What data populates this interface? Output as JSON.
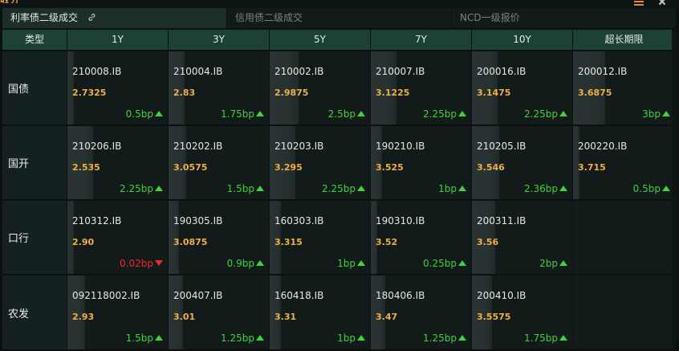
{
  "window": {
    "cut_title": "收分"
  },
  "tabs": [
    {
      "label": "利率债二级成交",
      "active": true
    },
    {
      "label": "信用债二级成交",
      "active": false
    },
    {
      "label": "NCD一级报价",
      "active": false
    }
  ],
  "table": {
    "headers": [
      "类型",
      "1Y",
      "3Y",
      "5Y",
      "7Y",
      "10Y",
      "超长期限"
    ],
    "rows": [
      {
        "label": "国债",
        "cells": [
          {
            "code": "210008.IB",
            "yield": "2.7325",
            "change": "0.5bp",
            "direction": "up",
            "level": 0.1
          },
          {
            "code": "210004.IB",
            "yield": "2.83",
            "change": "1.75bp",
            "direction": "up",
            "level": 0.28
          },
          {
            "code": "210002.IB",
            "yield": "2.9875",
            "change": "2.5bp",
            "direction": "up",
            "level": 0.5
          },
          {
            "code": "210007.IB",
            "yield": "3.1225",
            "change": "2.25bp",
            "direction": "up",
            "level": 0.45
          },
          {
            "code": "200016.IB",
            "yield": "3.1475",
            "change": "2.25bp",
            "direction": "up",
            "level": 0.45
          },
          {
            "code": "200012.IB",
            "yield": "3.6875",
            "change": "3bp",
            "direction": "up",
            "level": 0.55
          }
        ]
      },
      {
        "label": "国开",
        "cells": [
          {
            "code": "210206.IB",
            "yield": "2.535",
            "change": "2.25bp",
            "direction": "up",
            "level": 0.45
          },
          {
            "code": "210202.IB",
            "yield": "3.0575",
            "change": "1.5bp",
            "direction": "up",
            "level": 0.3
          },
          {
            "code": "210203.IB",
            "yield": "3.295",
            "change": "2.25bp",
            "direction": "up",
            "level": 0.45
          },
          {
            "code": "190210.IB",
            "yield": "3.525",
            "change": "1bp",
            "direction": "up",
            "level": 0.2
          },
          {
            "code": "210205.IB",
            "yield": "3.546",
            "change": "2.36bp",
            "direction": "up",
            "level": 0.47
          },
          {
            "code": "200220.IB",
            "yield": "3.715",
            "change": "0.5bp",
            "direction": "up",
            "level": 0.1
          }
        ]
      },
      {
        "label": "口行",
        "cells": [
          {
            "code": "210312.IB",
            "yield": "2.90",
            "change": "0.02bp",
            "direction": "down",
            "level": 0.0
          },
          {
            "code": "190305.IB",
            "yield": "3.0875",
            "change": "0.9bp",
            "direction": "up",
            "level": 0.18
          },
          {
            "code": "160303.IB",
            "yield": "3.315",
            "change": "1bp",
            "direction": "up",
            "level": 0.2
          },
          {
            "code": "190310.IB",
            "yield": "3.52",
            "change": "0.25bp",
            "direction": "up",
            "level": 0.05
          },
          {
            "code": "200311.IB",
            "yield": "3.56",
            "change": "2bp",
            "direction": "up",
            "level": 0.4
          },
          null
        ]
      },
      {
        "label": "农发",
        "cells": [
          {
            "code": "092118002.IB",
            "yield": "2.93",
            "change": "1.5bp",
            "direction": "up",
            "level": 0.3
          },
          {
            "code": "200407.IB",
            "yield": "3.01",
            "change": "1.25bp",
            "direction": "up",
            "level": 0.25
          },
          {
            "code": "160418.IB",
            "yield": "3.31",
            "change": "1bp",
            "direction": "up",
            "level": 0.2
          },
          {
            "code": "180406.IB",
            "yield": "3.47",
            "change": "1.25bp",
            "direction": "up",
            "level": 0.25
          },
          {
            "code": "200410.IB",
            "yield": "3.5575",
            "change": "1.75bp",
            "direction": "up",
            "level": 0.35
          },
          null
        ]
      }
    ]
  },
  "colors": {
    "up": "#3fd33f",
    "down": "#ee2a2a",
    "yield": "#f0b045",
    "header_bg": "#1d4037",
    "active_tab_bg": "#1d2e2a"
  }
}
